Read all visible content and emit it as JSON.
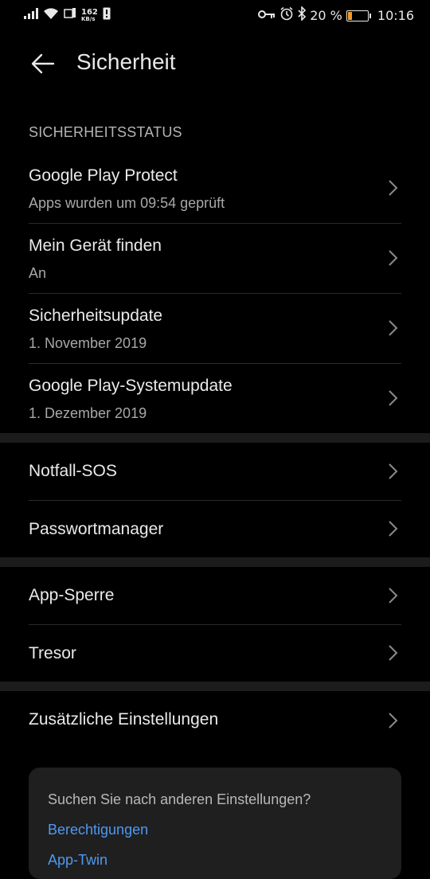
{
  "statusbar": {
    "speed_value": "162",
    "speed_unit": "KB/s",
    "battery_text": "20 %",
    "time": "10:16",
    "battery_color": "#f39b27"
  },
  "header": {
    "title": "Sicherheit"
  },
  "security_status": {
    "section_label": "SICHERHEITSSTATUS",
    "items": [
      {
        "title": "Google Play Protect",
        "subtitle": "Apps wurden um 09:54 geprüft"
      },
      {
        "title": "Mein Gerät finden",
        "subtitle": "An"
      },
      {
        "title": "Sicherheitsupdate",
        "subtitle": "1. November 2019"
      },
      {
        "title": "Google Play-Systemupdate",
        "subtitle": "1. Dezember 2019"
      }
    ]
  },
  "group2": {
    "items": [
      {
        "title": "Notfall-SOS"
      },
      {
        "title": "Passwortmanager"
      }
    ]
  },
  "group3": {
    "items": [
      {
        "title": "App-Sperre"
      },
      {
        "title": "Tresor"
      }
    ]
  },
  "group4": {
    "items": [
      {
        "title": "Zusätzliche Einstellungen"
      }
    ]
  },
  "suggestions": {
    "question": "Suchen Sie nach anderen Einstellungen?",
    "links": [
      "Berechtigungen",
      "App-Twin"
    ],
    "link_color": "#4f98f3"
  }
}
